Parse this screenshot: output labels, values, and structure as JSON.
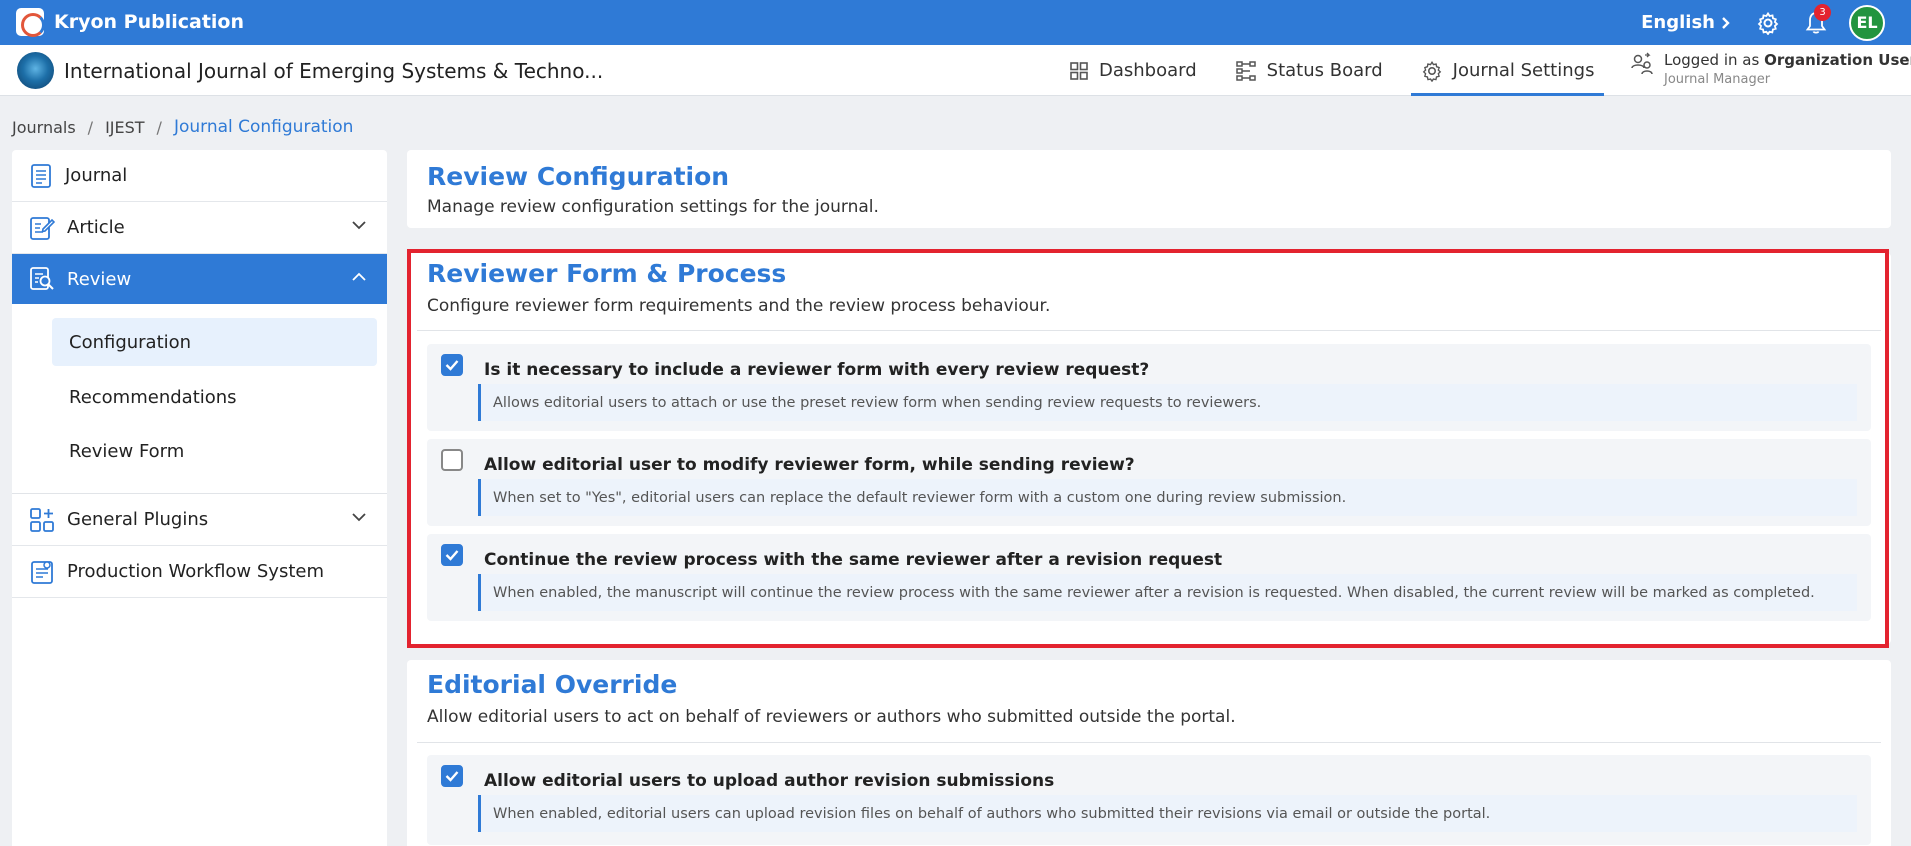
{
  "topbar": {
    "brand": "Kryon Publication",
    "language": "English",
    "notification_count": "3",
    "avatar_initials": "EL"
  },
  "header": {
    "journal_title": "International Journal of Emerging Systems & Techno...",
    "nav": [
      {
        "label": "Dashboard",
        "icon": "dashboard-icon"
      },
      {
        "label": "Status Board",
        "icon": "status-board-icon"
      },
      {
        "label": "Journal Settings",
        "icon": "settings-gear-icon",
        "active": true
      }
    ],
    "login_prefix": "Logged in as",
    "login_user": "Organization User",
    "login_role": "Journal Manager"
  },
  "breadcrumb": [
    "Journals",
    "IJEST",
    "Journal Configuration"
  ],
  "sidebar": {
    "items": [
      {
        "label": "Journal"
      },
      {
        "label": "Article"
      },
      {
        "label": "Review"
      },
      {
        "label": "General Plugins"
      },
      {
        "label": "Production Workflow System"
      }
    ],
    "review_sub": [
      "Configuration",
      "Recommendations",
      "Review Form"
    ]
  },
  "main": {
    "header_title": "Review Configuration",
    "header_desc": "Manage review configuration settings for the journal.",
    "sections": [
      {
        "title": "Reviewer Form & Process",
        "desc": "Configure reviewer form requirements and the review process behaviour.",
        "options": [
          {
            "checked": true,
            "label": "Is it necessary to include a reviewer form with every review request?",
            "help": "Allows editorial users to attach or use the preset review form when sending review requests to reviewers."
          },
          {
            "checked": false,
            "label": "Allow editorial user to modify reviewer form, while sending review?",
            "help": "When set to \"Yes\", editorial users can replace the default reviewer form with a custom one during review submission."
          },
          {
            "checked": true,
            "label": "Continue the review process with the same reviewer after a revision request",
            "help": "When enabled, the manuscript will continue the review process with the same reviewer after a revision is requested. When disabled, the current review will be marked as completed."
          }
        ]
      },
      {
        "title": "Editorial Override",
        "desc": "Allow editorial users to act on behalf of reviewers or authors who submitted outside the portal.",
        "options": [
          {
            "checked": true,
            "label": "Allow editorial users to upload author revision submissions",
            "help": "When enabled, editorial users can upload revision files on behalf of authors who submitted their revisions via email or outside the portal."
          }
        ]
      }
    ]
  },
  "colors": {
    "accent": "#2f7ad6",
    "highlight": "#e3232f",
    "avatar": "#23943f"
  }
}
